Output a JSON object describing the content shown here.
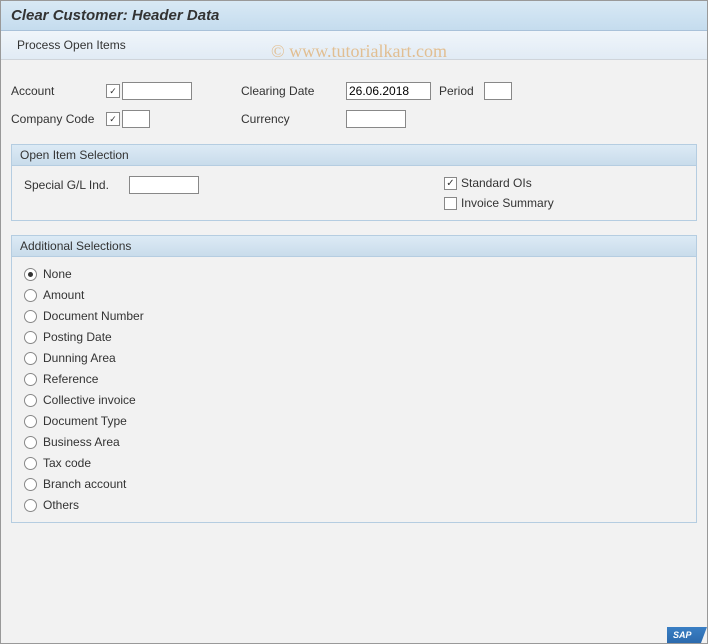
{
  "title": "Clear Customer: Header Data",
  "toolbar": {
    "process_label": "Process Open Items"
  },
  "fields": {
    "account_label": "Account",
    "account_value": "",
    "company_code_label": "Company Code",
    "company_code_value": "",
    "clearing_date_label": "Clearing Date",
    "clearing_date_value": "26.06.2018",
    "period_label": "Period",
    "period_value": "",
    "currency_label": "Currency",
    "currency_value": ""
  },
  "open_item_selection": {
    "title": "Open Item Selection",
    "special_gl_label": "Special G/L Ind.",
    "special_gl_value": "",
    "standard_ois_label": "Standard OIs",
    "standard_ois_checked": true,
    "invoice_summary_label": "Invoice Summary",
    "invoice_summary_checked": false
  },
  "additional_selections": {
    "title": "Additional Selections",
    "selected_index": 0,
    "options": [
      "None",
      "Amount",
      "Document Number",
      "Posting Date",
      "Dunning Area",
      "Reference",
      "Collective invoice",
      "Document Type",
      "Business Area",
      "Tax code",
      "Branch account",
      "Others"
    ]
  },
  "watermark": "© www.tutorialkart.com",
  "logo": "SAP"
}
